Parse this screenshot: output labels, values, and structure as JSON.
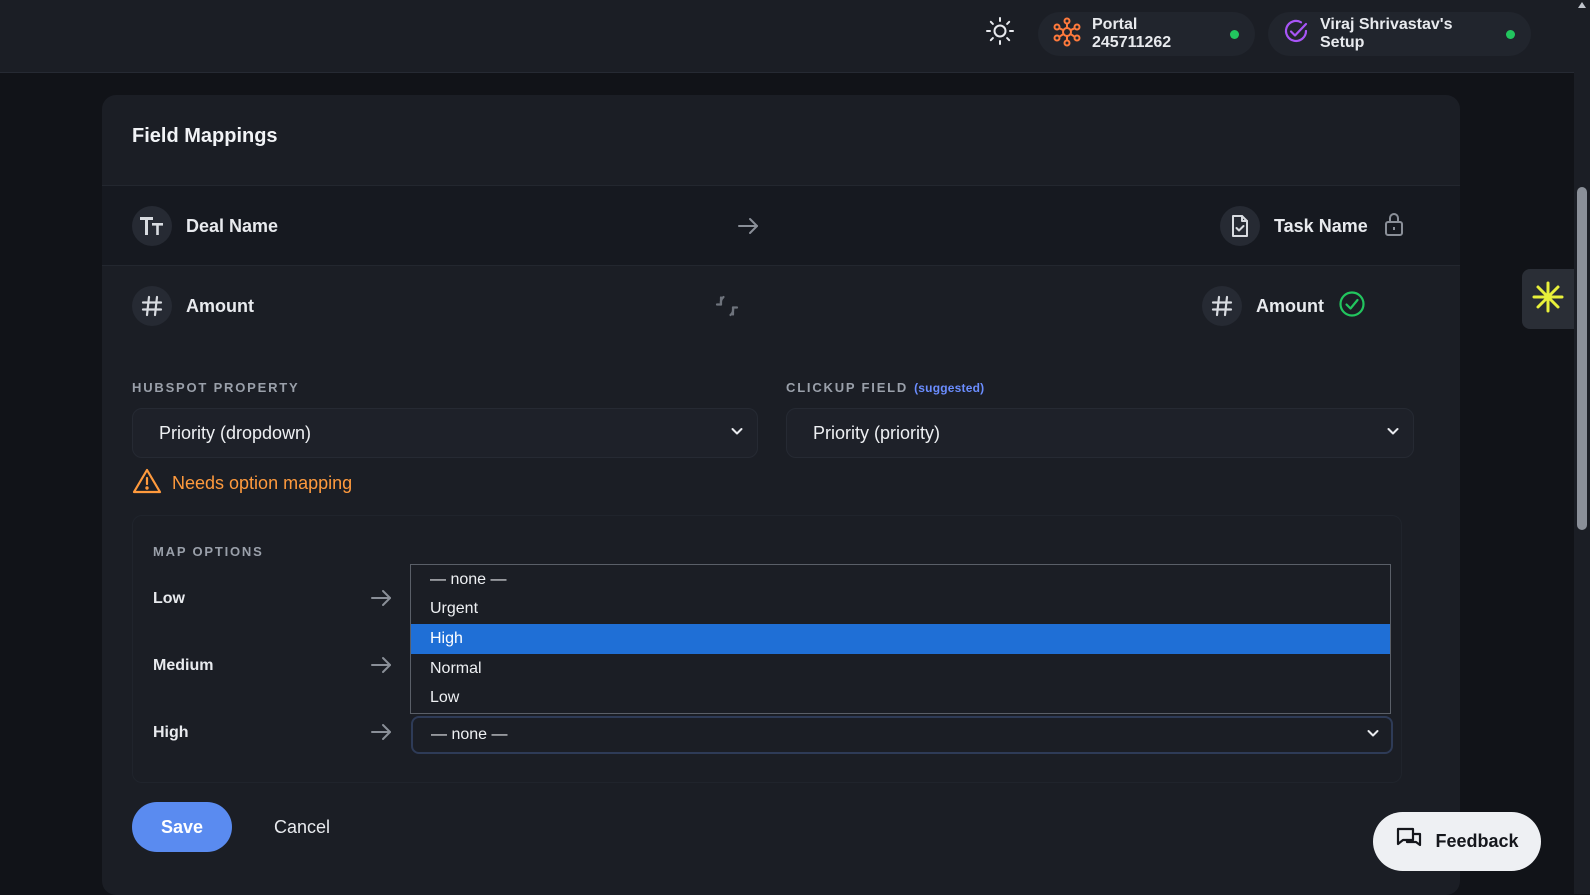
{
  "topbar": {
    "portal_label": "Portal 245711262",
    "setup_label": "Viraj Shrivastav's Setup",
    "icons": {
      "theme": "sun-icon",
      "portal": "hubspot-sprocket-icon",
      "setup": "clickup-check-icon"
    },
    "status_color": "#22c55e"
  },
  "card": {
    "title": "Field Mappings",
    "rows": [
      {
        "left_label": "Deal Name",
        "left_icon": "text-type-icon",
        "right_label": "Task Name",
        "right_icon": "document-check-icon",
        "status_icon": "lock-icon"
      },
      {
        "left_label": "Amount",
        "left_icon": "hash-icon",
        "right_label": "Amount",
        "right_icon": "hash-icon",
        "status_icon": "check-circle-icon"
      }
    ],
    "hubspot_label": "HUBSPOT PROPERTY",
    "clickup_label": "CLICKUP FIELD",
    "suggested_label": "(suggested)",
    "hubspot_value": "Priority (dropdown)",
    "clickup_value": "Priority (priority)",
    "warning_text": "Needs option mapping",
    "map_options": {
      "title": "MAP OPTIONS",
      "rows": [
        {
          "label": "Low"
        },
        {
          "label": "Medium"
        },
        {
          "label": "High",
          "selected": "— none —"
        }
      ]
    },
    "dropdown": {
      "options": [
        "— none —",
        "Urgent",
        "High",
        "Normal",
        "Low"
      ],
      "highlighted": "High"
    },
    "save_label": "Save",
    "cancel_label": "Cancel"
  },
  "feedback_label": "Feedback",
  "colors": {
    "accent": "#5a8bf0",
    "warning": "#ff9a3d",
    "highlight": "#1f6fd6",
    "success": "#22c55e"
  }
}
